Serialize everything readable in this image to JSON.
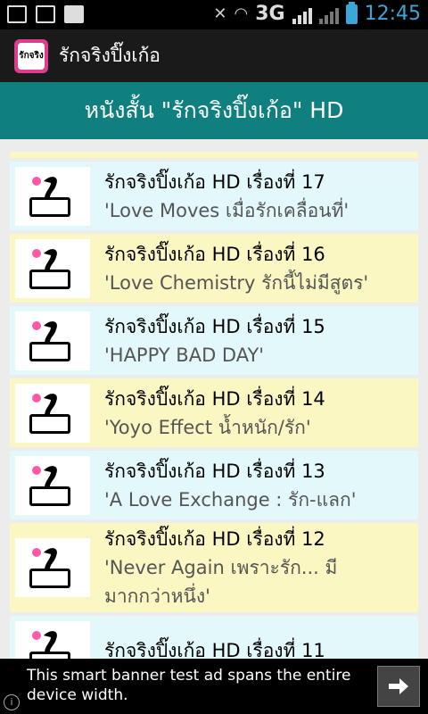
{
  "status": {
    "network": "3G",
    "time": "12:45"
  },
  "app": {
    "title": "รักจริงปิ๊งเก้อ",
    "icon_label": "รักจริง"
  },
  "header": {
    "title": "หนังสั้น \"รักจริงปิ๊งเก้อ\" HD"
  },
  "items": [
    {
      "title": "รักจริงปิ๊งเก้อ HD เรื่องที่ 17",
      "subtitle": "'Love Moves เมื่อรักเคลื่อนที่'",
      "color": "blue"
    },
    {
      "title": "รักจริงปิ๊งเก้อ HD เรื่องที่ 16",
      "subtitle": "'Love Chemistry รักนี้ไม่มีสูตร'",
      "color": "yellow"
    },
    {
      "title": "รักจริงปิ๊งเก้อ HD เรื่องที่ 15",
      "subtitle": "'HAPPY BAD DAY'",
      "color": "blue"
    },
    {
      "title": "รักจริงปิ๊งเก้อ HD เรื่องที่ 14",
      "subtitle": "'Yoyo Effect น้ำหนัก/รัก'",
      "color": "yellow"
    },
    {
      "title": "รักจริงปิ๊งเก้อ HD เรื่องที่ 13",
      "subtitle": "'A Love Exchange : รัก-แลก'",
      "color": "blue"
    },
    {
      "title": "รักจริงปิ๊งเก้อ HD เรื่องที่ 12",
      "subtitle": "'Never Again เพราะรัก... มีมากกว่าหนึ่ง'",
      "color": "yellow"
    },
    {
      "title": "รักจริงปิ๊งเก้อ HD เรื่องที่ 11",
      "subtitle": "",
      "color": "blue"
    }
  ],
  "ad": {
    "text": "This smart banner test ad spans the entire device width.",
    "info": "i"
  },
  "colors": {
    "header": "#0f7f7f",
    "row_blue": "#e3f8fb",
    "row_yellow": "#fbf7c2",
    "time": "#3aa7d8"
  }
}
